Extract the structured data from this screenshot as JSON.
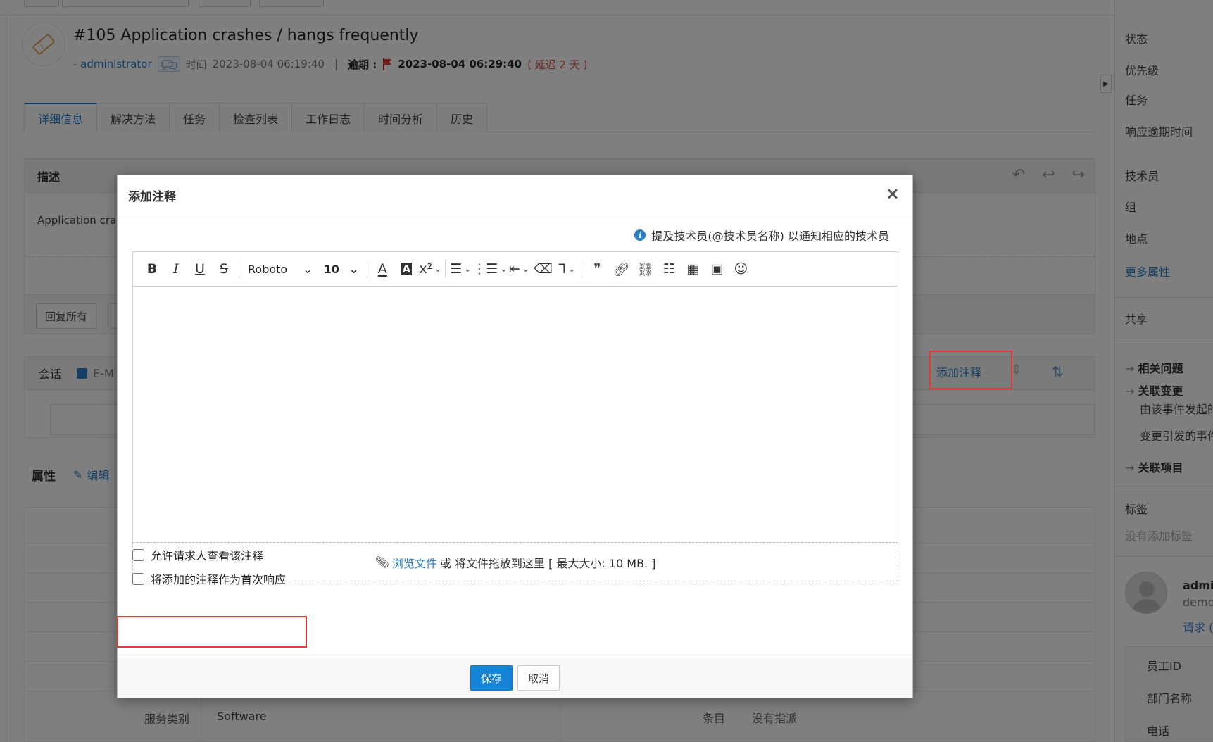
{
  "ticket": {
    "title": "#105  Application crashes / hangs frequently",
    "author": "- administrator",
    "time_label": "时间",
    "time_value": "2023-08-04 06:19:40",
    "separator": "|",
    "due_label": "逾期 :",
    "due_value": "2023-08-04 06:29:40",
    "delay": "( 延迟 2 天 )"
  },
  "tabs": [
    "详细信息",
    "解决方法",
    "任务",
    "检查列表",
    "工作日志",
    "时间分析",
    "历史"
  ],
  "description": {
    "heading": "描述",
    "text": "Application cras",
    "reply_all": "回复所有"
  },
  "conversation": {
    "label": "会话",
    "email_filter": "E-M",
    "add_note": "添加注释"
  },
  "attributes": {
    "heading": "属性",
    "edit": "编辑",
    "service_category_label": "服务类别",
    "service_category_value": "Software",
    "item_label": "条目",
    "item_value": "没有指派"
  },
  "right_panel": {
    "status": "状态",
    "priority": "优先级",
    "tasks": "任务",
    "response_due": "响应逾期时间",
    "technician": "技术员",
    "group": "组",
    "site": "地点",
    "more_props": "更多属性",
    "share": "共享",
    "related_issues": "相关问题",
    "related_changes": "关联变更",
    "changes_from": "由该事件发起的",
    "changes_caused": "变更引发的事件",
    "related_items": "关联项目",
    "tags": "标签",
    "no_tags": "没有添加标签",
    "user_name": "admin",
    "user_sub": "demo",
    "requests": "请求 (",
    "employee_id": "员工ID",
    "dept": "部门名称",
    "phone": "电话"
  },
  "modal": {
    "title": "添加注释",
    "close": "×",
    "hint": "提及技术员(@技术员名称) 以通知相应的技术员",
    "font": "Roboto",
    "font_size": "10",
    "attach_link": "浏览文件",
    "attach_text": "或 将文件拖放到这里 [ 最大大小:  10 MB. ]",
    "allow_requester": "允许请求人查看该注释",
    "first_response": "将添加的注释作为首次响应",
    "save": "保存",
    "cancel": "取消"
  }
}
